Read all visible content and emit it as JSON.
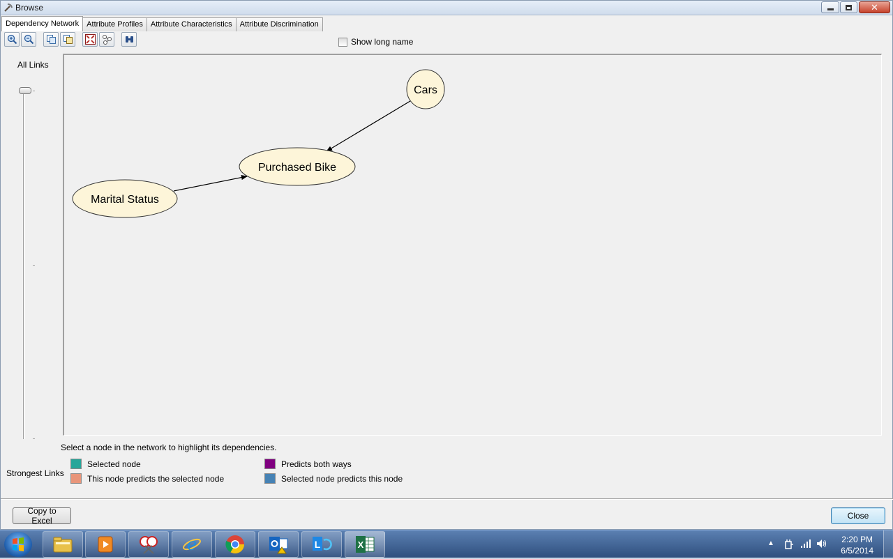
{
  "window": {
    "title": "Browse"
  },
  "tabs": [
    {
      "label": "Dependency Network",
      "active": true
    },
    {
      "label": "Attribute Profiles",
      "active": false
    },
    {
      "label": "Attribute Characteristics",
      "active": false
    },
    {
      "label": "Attribute Discrimination",
      "active": false
    }
  ],
  "toolbar": {
    "buttons": [
      "zoom-in-icon",
      "zoom-out-icon",
      "copy-icon",
      "copy-graph-icon",
      "fit-icon",
      "layout-icon",
      "find-icon"
    ]
  },
  "options": {
    "show_long_name_label": "Show long name",
    "show_long_name_checked": false
  },
  "slider": {
    "top_label": "All Links",
    "bottom_label": "Strongest Links"
  },
  "network": {
    "nodes": [
      {
        "id": "cars",
        "label": "Cars"
      },
      {
        "id": "purchased_bike",
        "label": "Purchased Bike"
      },
      {
        "id": "marital_status",
        "label": "Marital Status"
      }
    ],
    "edges": [
      {
        "from": "cars",
        "to": "purchased_bike"
      },
      {
        "from": "marital_status",
        "to": "purchased_bike"
      }
    ],
    "node_fill": "#fdf5d9",
    "node_stroke": "#333333"
  },
  "hint_text": "Select a node in the network to highlight its dependencies.",
  "legend": [
    {
      "label": "Selected node",
      "color": "#26a69a"
    },
    {
      "label": "This node predicts the selected node",
      "color": "#e8957a"
    },
    {
      "label": "Predicts both ways",
      "color": "#800080"
    },
    {
      "label": "Selected node predicts this node",
      "color": "#4682b4"
    }
  ],
  "buttons": {
    "copy_to_excel": "Copy to Excel",
    "close": "Close"
  },
  "taskbar": {
    "apps": [
      "file-explorer-icon",
      "media-player-icon",
      "snipping-tool-icon",
      "internet-explorer-icon",
      "chrome-icon",
      "outlook-icon",
      "lync-icon",
      "excel-icon"
    ],
    "time": "2:20 PM",
    "date": "6/5/2014"
  }
}
